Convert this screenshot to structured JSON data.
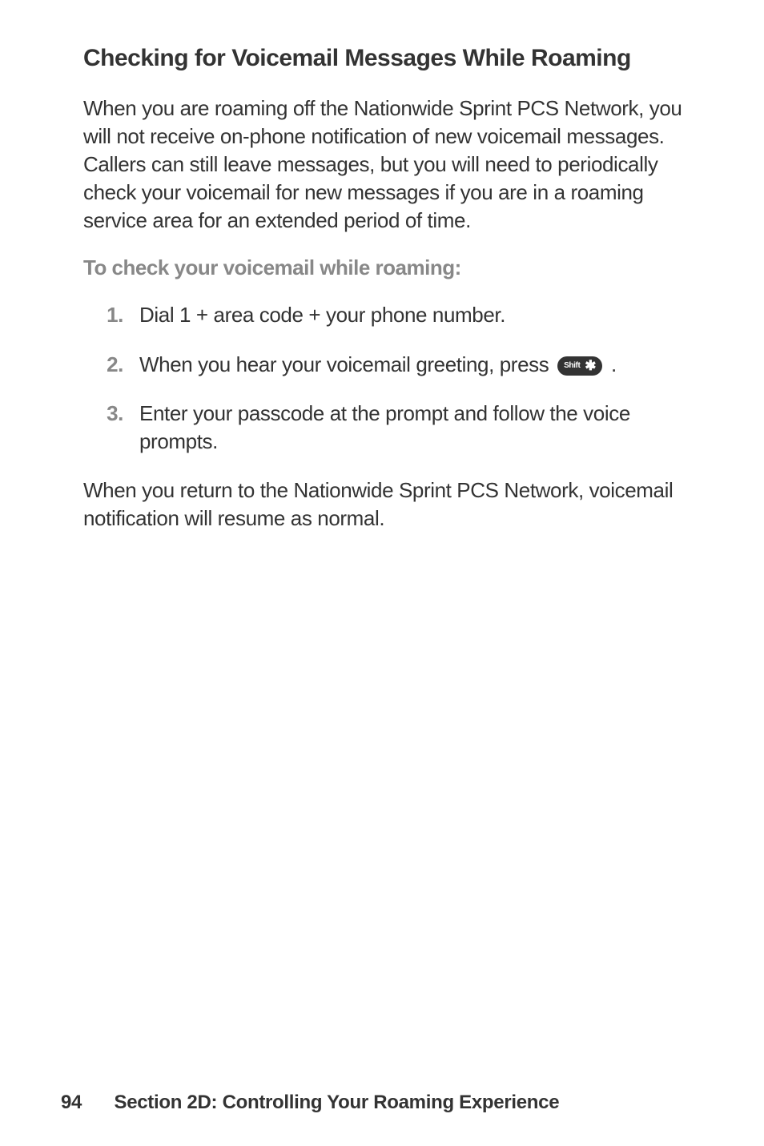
{
  "heading": "Checking for Voicemail Messages While Roaming",
  "intro": "When you are roaming off the Nationwide Sprint PCS Network, you will not receive on-phone notification of new voicemail messages. Callers can still leave messages, but you will need to periodically check your voicemail for new messages if you are in a roaming service area for an extended period of time.",
  "subheading": "To check your voicemail while roaming:",
  "steps": {
    "one": {
      "num": "1.",
      "text": "Dial 1 + area code + your phone number."
    },
    "two": {
      "num": "2.",
      "pre": "When you hear your voicemail greeting, press ",
      "key": "Shift",
      "post": " ."
    },
    "three": {
      "num": "3.",
      "text": "Enter your passcode at the prompt and follow the voice prompts."
    }
  },
  "outro": "When you return to the Nationwide Sprint PCS Network, voicemail notification will resume as normal.",
  "footer": {
    "page": "94",
    "section": "Section 2D: Controlling Your Roaming Experience"
  }
}
